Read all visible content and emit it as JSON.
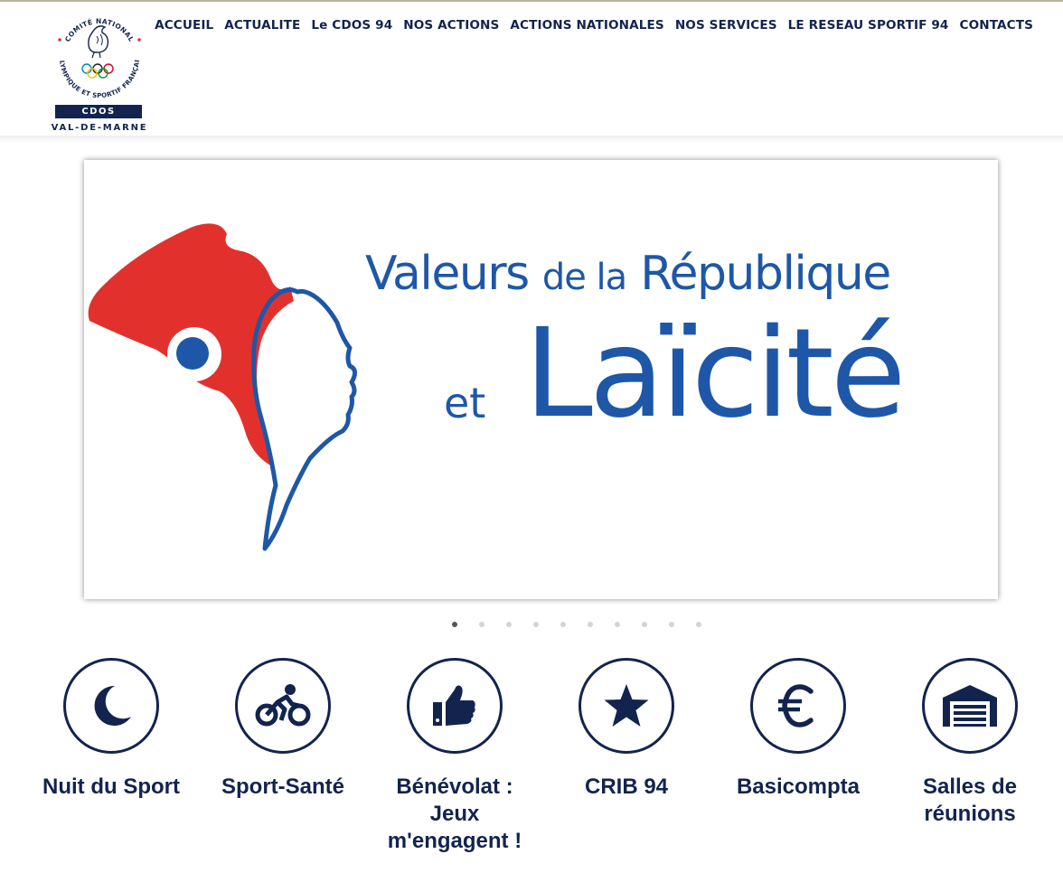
{
  "logo": {
    "arc_text": "COMITÉ NATIONAL OLYMPIQUE ET SPORTIF FRANÇAIS",
    "cdos": "CDOS",
    "region": "VAL-DE-MARNE"
  },
  "nav": {
    "items": [
      "ACCUEIL",
      "ACTUALITE",
      "Le CDOS 94",
      "NOS ACTIONS",
      "ACTIONS NATIONALES",
      "NOS SERVICES",
      "LE RESEAU SPORTIF 94",
      "CONTACTS"
    ]
  },
  "slider": {
    "line1_a": "Valeurs",
    "line1_b": "de la",
    "line1_c": "République",
    "line2_a": "et",
    "line2_b": "Laïcité",
    "slide_count": 10,
    "active_slide": 1
  },
  "services": [
    {
      "label": "Nuit du Sport",
      "icon": "moon-icon"
    },
    {
      "label": "Sport-Santé",
      "icon": "cyclist-icon"
    },
    {
      "label": "Bénévolat : Jeux m'engagent !",
      "icon": "thumbs-up-icon"
    },
    {
      "label": "CRIB 94",
      "icon": "star-icon"
    },
    {
      "label": "Basicompta",
      "icon": "euro-icon"
    },
    {
      "label": "Salles de réunions",
      "icon": "garage-icon"
    }
  ],
  "colors": {
    "navy": "#12244e",
    "blue": "#1e57a7",
    "red": "#e2312c"
  }
}
